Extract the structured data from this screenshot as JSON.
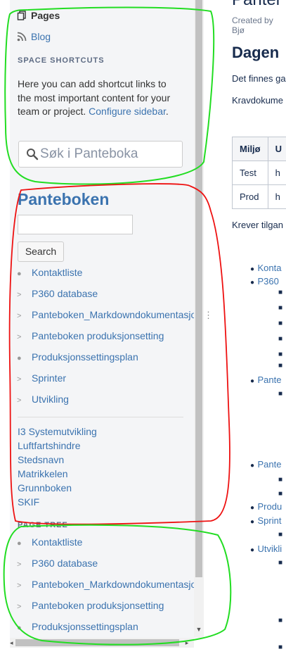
{
  "sidebar": {
    "pages_label": "Pages",
    "blog_label": "Blog",
    "space_shortcuts_heading": "SPACE SHORTCUTS",
    "shortcut_text": "Here you can add shortcut links to the most important content for your team or project.",
    "configure_link": "Configure sidebar",
    "search_placeholder": "Søk i Panteboka",
    "space_title": "Panteboken",
    "search_button": "Search",
    "children": [
      {
        "label": "Kontaktliste",
        "marker": "bullet"
      },
      {
        "label": "P360 database",
        "marker": "chevron"
      },
      {
        "label": "Panteboken_Markdowndokumentasjon",
        "marker": "chevron"
      },
      {
        "label": "Panteboken produksjonsetting",
        "marker": "chevron"
      },
      {
        "label": "Produksjonssettingsplan",
        "marker": "bullet"
      },
      {
        "label": "Sprinter",
        "marker": "chevron"
      },
      {
        "label": "Utvikling",
        "marker": "chevron"
      }
    ],
    "links": [
      "I3 Systemutvikling",
      "Luftfartshindre",
      "Stedsnavn",
      "Matrikkelen",
      "Grunnboken",
      "SKIF"
    ],
    "page_tree_heading": "PAGE TREE",
    "page_tree": [
      {
        "label": "Kontaktliste",
        "marker": "bullet"
      },
      {
        "label": "P360 database",
        "marker": "chevron"
      },
      {
        "label": "Panteboken_Markdowndokumentasjon",
        "marker": "chevron"
      },
      {
        "label": "Panteboken produksjonsetting",
        "marker": "chevron"
      },
      {
        "label": "Produksjonssettingsplan",
        "marker": "bullet"
      }
    ]
  },
  "main": {
    "title": "Pantel",
    "created_by": "Created by Bjø",
    "heading": "Dagen",
    "para1": "Det finnes ga",
    "para2": "Kravdokume",
    "table": {
      "headers": [
        "Miljø",
        "U"
      ],
      "rows": [
        [
          "Test",
          "h"
        ],
        [
          "Prod",
          "h"
        ]
      ]
    },
    "after_table": "Krever tilgan",
    "bullets": [
      "Konta",
      "P360",
      "Pante",
      "Pante",
      "Produ",
      "Sprint",
      "Utvikli"
    ]
  },
  "annotations": {
    "green_color": "#22dd22",
    "red_color": "#ee1111"
  }
}
